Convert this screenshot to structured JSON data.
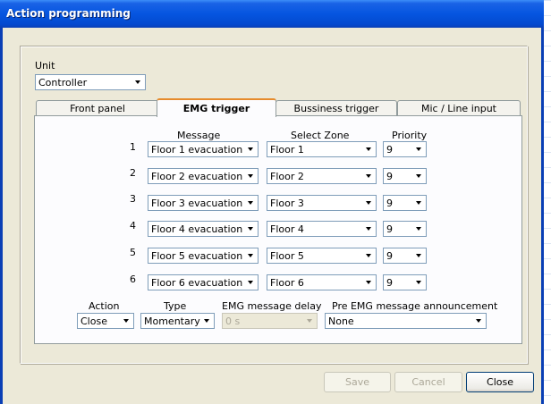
{
  "window": {
    "title": "Action programming"
  },
  "unit": {
    "label": "Unit",
    "value": "Controller"
  },
  "tabs": [
    {
      "label": "Front panel"
    },
    {
      "label": "EMG trigger"
    },
    {
      "label": "Bussiness trigger"
    },
    {
      "label": "Mic / Line input"
    }
  ],
  "table": {
    "headers": {
      "message": "Message",
      "zone": "Select Zone",
      "priority": "Priority"
    },
    "rows": [
      {
        "num": "1",
        "message": "Floor 1 evacuation",
        "zone": "Floor 1",
        "priority": "9"
      },
      {
        "num": "2",
        "message": "Floor 2 evacuation",
        "zone": "Floor 2",
        "priority": "9"
      },
      {
        "num": "3",
        "message": "Floor 3 evacuation",
        "zone": "Floor 3",
        "priority": "9"
      },
      {
        "num": "4",
        "message": "Floor 4 evacuation",
        "zone": "Floor 4",
        "priority": "9"
      },
      {
        "num": "5",
        "message": "Floor 5 evacuation",
        "zone": "Floor 5",
        "priority": "9"
      },
      {
        "num": "6",
        "message": "Floor 6 evacuation",
        "zone": "Floor 6",
        "priority": "9"
      }
    ]
  },
  "bottom": {
    "action": {
      "label": "Action",
      "value": "Close"
    },
    "type": {
      "label": "Type",
      "value": "Momentary"
    },
    "delay": {
      "label": "EMG message delay",
      "value": "0 s"
    },
    "pre": {
      "label": "Pre EMG message announcement",
      "value": "None"
    }
  },
  "buttons": {
    "save": "Save",
    "cancel": "Cancel",
    "close": "Close"
  },
  "colors": {
    "titlebar": "#0555e0",
    "window_bg": "#ece9d8",
    "tab_highlight": "#e68b2c"
  }
}
